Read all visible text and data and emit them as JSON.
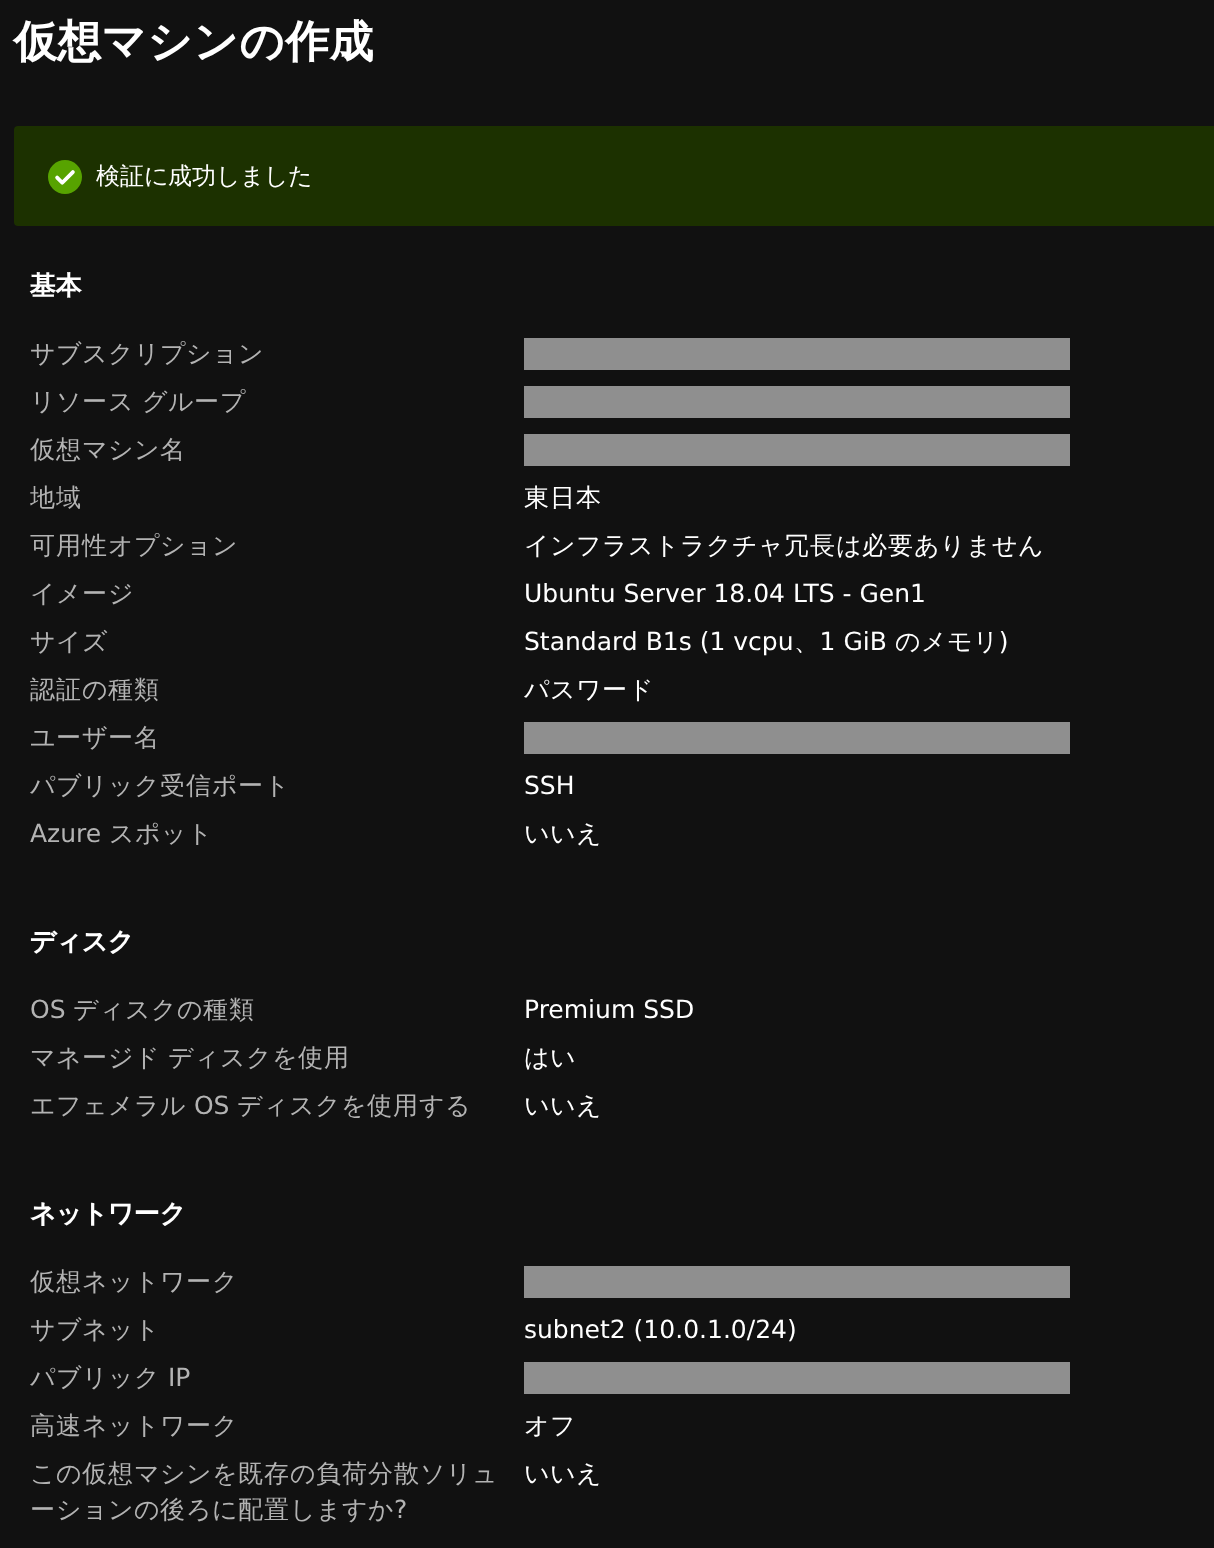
{
  "title": "仮想マシンの作成",
  "banner": {
    "kind": "success",
    "message": "検証に成功しました"
  },
  "sections": [
    {
      "heading": "基本",
      "rows": [
        {
          "label": "サブスクリプション",
          "kind": "redacted"
        },
        {
          "label": "リソース グループ",
          "kind": "redacted"
        },
        {
          "label": "仮想マシン名",
          "kind": "redacted"
        },
        {
          "label": "地域",
          "kind": "text",
          "value": "東日本"
        },
        {
          "label": "可用性オプション",
          "kind": "text",
          "value": "インフラストラクチャ冗長は必要ありません"
        },
        {
          "label": "イメージ",
          "kind": "text",
          "value": "Ubuntu Server 18.04 LTS - Gen1"
        },
        {
          "label": "サイズ",
          "kind": "text",
          "value": "Standard B1s (1 vcpu、1 GiB のメモリ)"
        },
        {
          "label": "認証の種類",
          "kind": "text",
          "value": "パスワード"
        },
        {
          "label": "ユーザー名",
          "kind": "redacted"
        },
        {
          "label": "パブリック受信ポート",
          "kind": "text",
          "value": "SSH"
        },
        {
          "label": "Azure スポット",
          "kind": "text",
          "value": "いいえ"
        }
      ]
    },
    {
      "heading": "ディスク",
      "rows": [
        {
          "label": "OS ディスクの種類",
          "kind": "text",
          "value": "Premium SSD"
        },
        {
          "label": "マネージド ディスクを使用",
          "kind": "text",
          "value": "はい"
        },
        {
          "label": "エフェメラル OS ディスクを使用する",
          "kind": "text",
          "value": "いいえ"
        }
      ]
    },
    {
      "heading": "ネットワーク",
      "rows": [
        {
          "label": "仮想ネットワーク",
          "kind": "redacted"
        },
        {
          "label": "サブネット",
          "kind": "text",
          "value": "subnet2 (10.0.1.0/24)"
        },
        {
          "label": "パブリック IP",
          "kind": "redacted"
        },
        {
          "label": "高速ネットワーク",
          "kind": "text",
          "value": "オフ"
        },
        {
          "label": "この仮想マシンを既存の負荷分散ソリューションの後ろに配置しますか?",
          "kind": "text",
          "value": "いいえ"
        }
      ]
    }
  ]
}
